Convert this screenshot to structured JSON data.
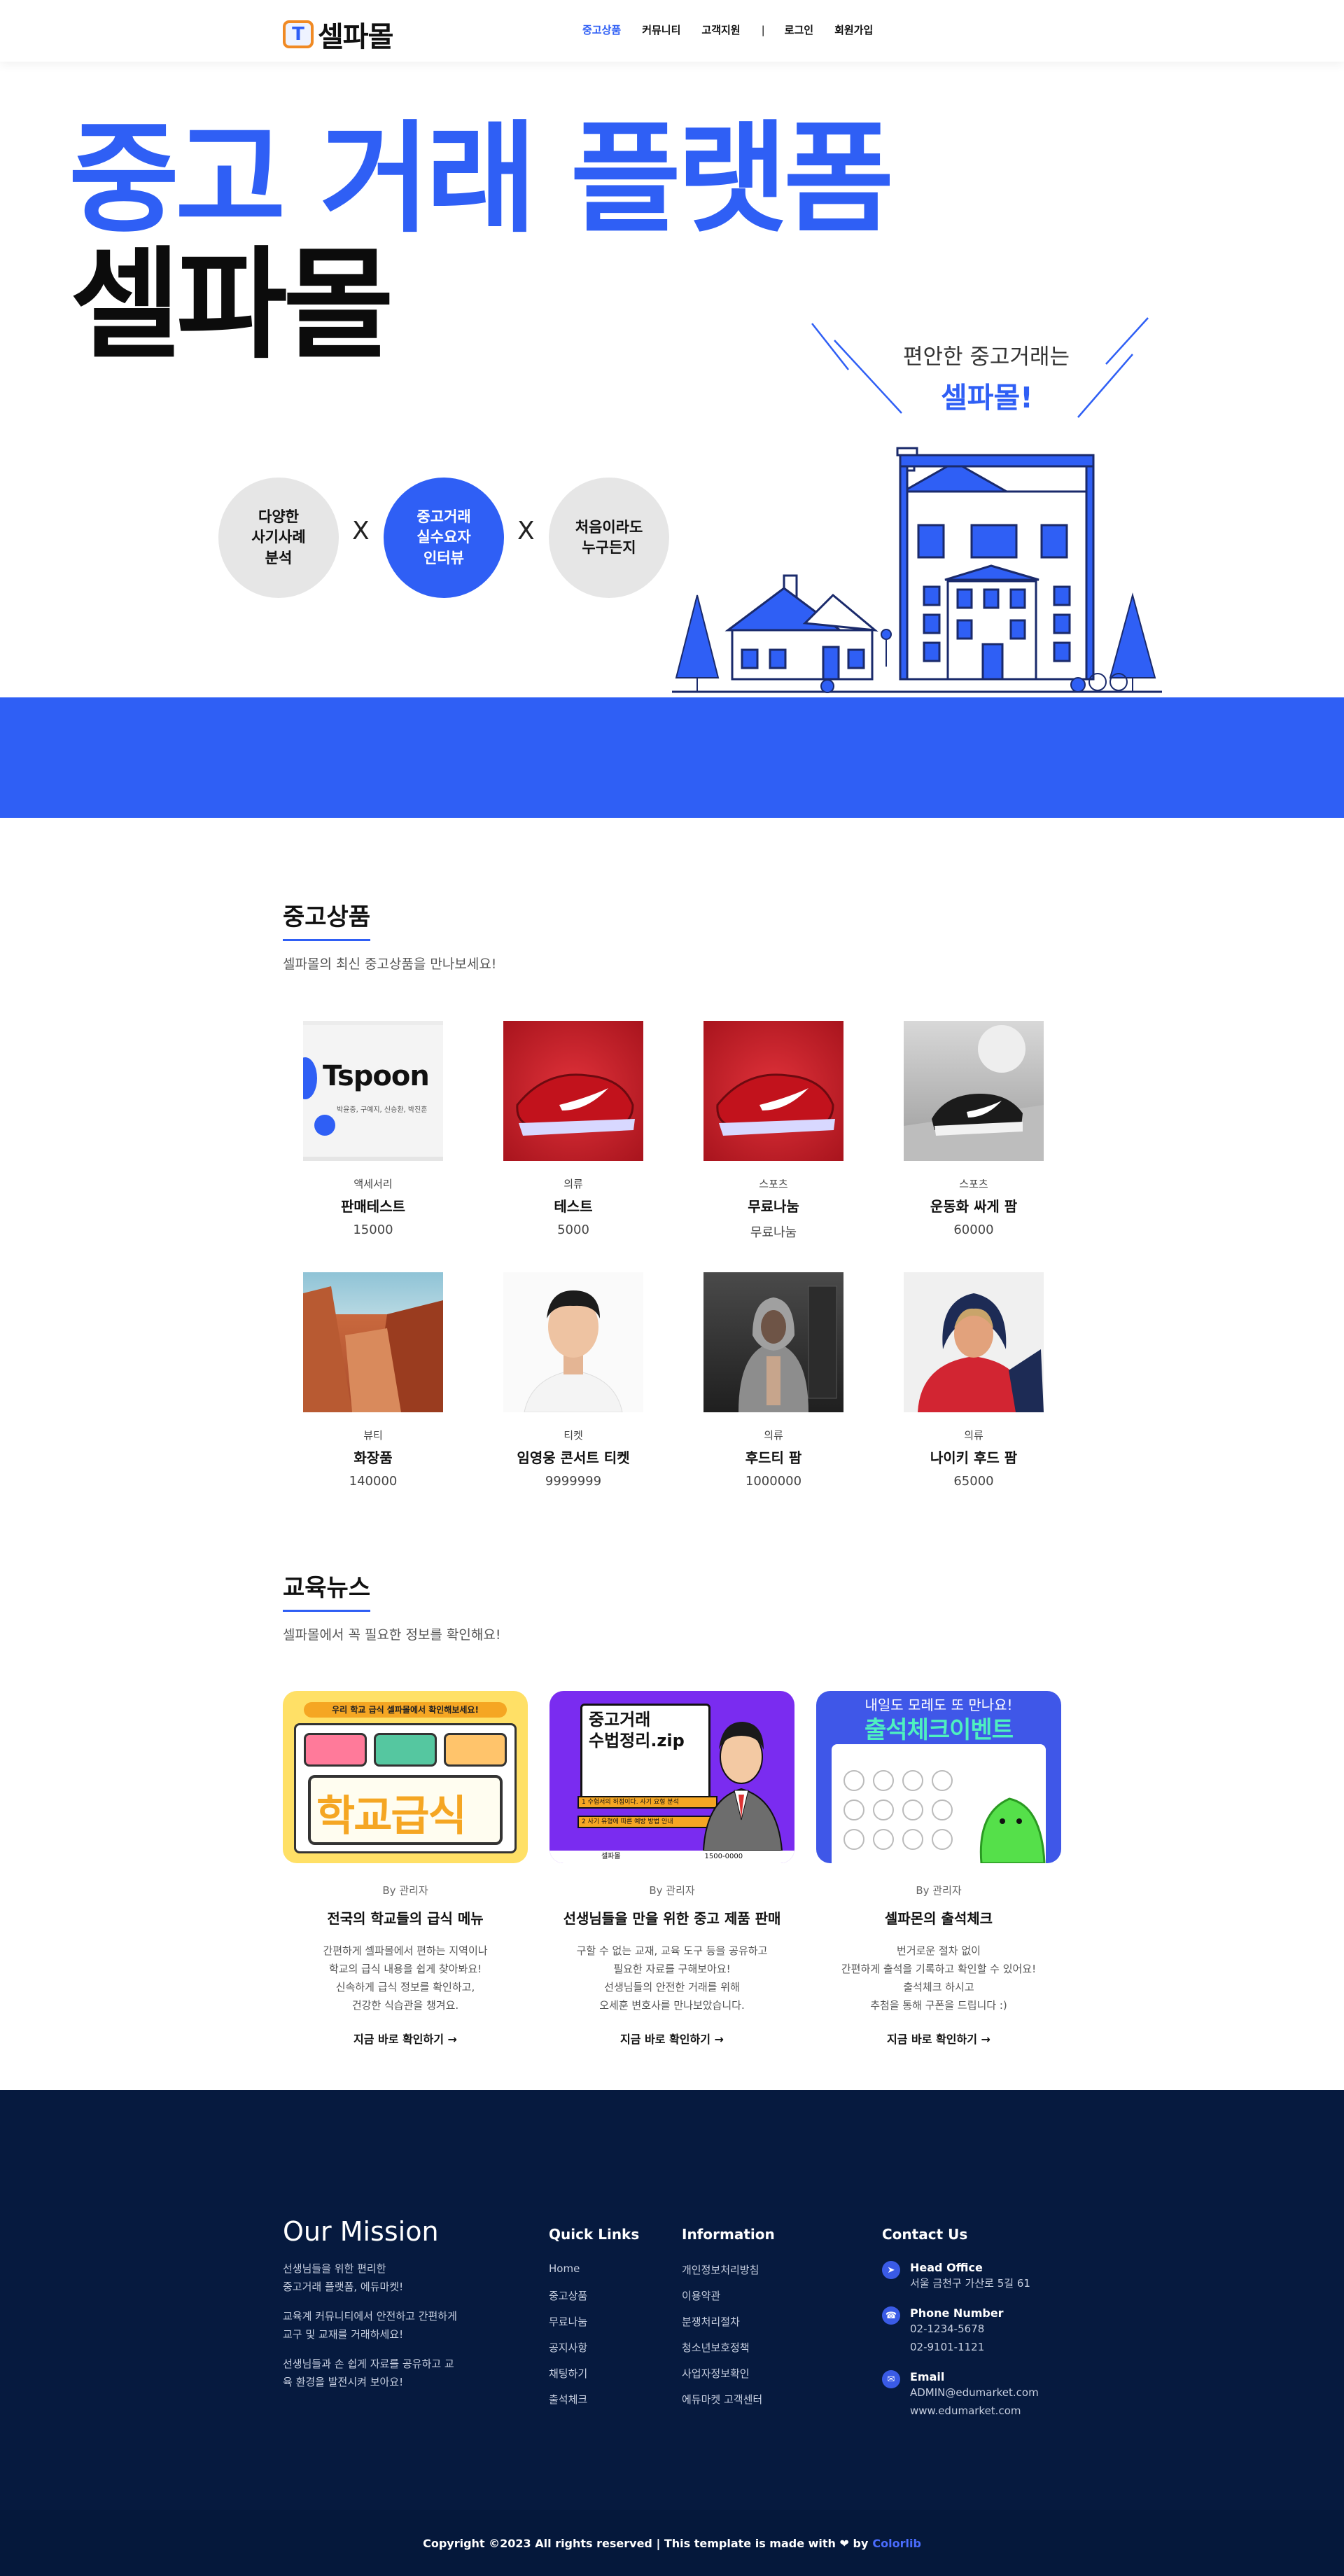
{
  "nav": {
    "logo_text": "셀파몰",
    "items": [
      "중고상품",
      "커뮤니티",
      "고객지원",
      "|",
      "로그인",
      "회원가입"
    ],
    "active": "중고상품"
  },
  "hero": {
    "line1": "중고 거래 플랫폼",
    "line2": "셀파몰",
    "bubbles": [
      "다양한\n사기사례\n분석",
      "중고거래\n실수요자\n인터뷰",
      "처음이라도\n누구든지"
    ],
    "x_mark": "X",
    "town_caption": "편안한 중고거래는",
    "town_brand": "셀파몰!"
  },
  "products": {
    "title": "중고상품",
    "subtitle": "셀파몰의 최신 중고상품을 만나보세요!",
    "items": [
      {
        "category": "액세서리",
        "name": "판매테스트",
        "price": "15000",
        "image": "tspoon-banner"
      },
      {
        "category": "의류",
        "name": "테스트",
        "price": "5000",
        "image": "red-sneaker"
      },
      {
        "category": "스포츠",
        "name": "무료나눔",
        "price": "무료나눔",
        "image": "red-sneaker"
      },
      {
        "category": "스포츠",
        "name": "운동화 싸게 팜",
        "price": "60000",
        "image": "black-sneaker"
      },
      {
        "category": "뷰티",
        "name": "화장품",
        "price": "140000",
        "image": "canyon"
      },
      {
        "category": "티켓",
        "name": "임영웅 콘서트 티켓",
        "price": "9999999",
        "image": "man-portrait"
      },
      {
        "category": "의류",
        "name": "후드티 팜",
        "price": "1000000",
        "image": "hoodie-man"
      },
      {
        "category": "의류",
        "name": "나이키 후드 팜",
        "price": "65000",
        "image": "hoodie-woman"
      }
    ],
    "tspoon_brand": "Tspoon",
    "tspoon_names": "박윤중, 구예지, 신승환, 박진훈"
  },
  "news": {
    "title": "교육뉴스",
    "subtitle": "셀파몰에서 꼭 필요한 정보를 확인해요!",
    "items": [
      {
        "by": "By 관리자",
        "title": "전국의 학교들의 급식 메뉴",
        "desc": [
          "간편하게 셀파몰에서 편하는 지역이나",
          "학교의 급식 내용을 쉽게 찾아봐요!",
          "신속하게 급식 정보를 확인하고,",
          "건강한 식습관을 챙겨요."
        ],
        "link": "지금 바로 확인하기 →",
        "banner_top": "우리 학교 급식 셀파몰에서 확인해보세요!",
        "banner_main": "학교급식"
      },
      {
        "by": "By 관리자",
        "title": "선생님들을 만을 위한 중고 제품 판매",
        "desc": [
          "구할 수 없는 교재, 교육 도구 등을 공유하고",
          "필요한 자료를 구해보아요!",
          "선생님들의 안전한 거래를 위해",
          "오세훈 변호사를 만나보았습니다."
        ],
        "link": "지금 바로 확인하기 →",
        "banner_main": "중고거래\n수법정리.zip",
        "banner_item1": "1 수험서의 허점이다. 사기 요형 분석",
        "banner_item2": "2 사기 유형에 따른 예방 방법 안내",
        "banner_footer_left": "셀파몰",
        "banner_footer_right": "1500-0000"
      },
      {
        "by": "By 관리자",
        "title": "셀파몬의 출석체크",
        "desc": [
          "번거로운 절차 없이",
          "간편하게 출석을 기록하고 확인할 수 있어요!",
          "출석체크 하시고",
          "추첨을 통해 구폰을 드립니다 :)"
        ],
        "link": "지금 바로 확인하기 →",
        "banner_top": "내일도 모레도 또 만나요!",
        "banner_main": "출석체크이벤트"
      }
    ]
  },
  "footer": {
    "mission_title": "Our Mission",
    "mission_paragraphs": [
      [
        "선생님들을 위한 편리한",
        "중고거래 플랫폼, 에듀마켓!"
      ],
      [
        "교육계 커뮤니티에서 안전하고 간편하게",
        "교구 및 교재를 거래하세요!"
      ],
      [
        "선생님들과 손 쉽게 자료를 공유하고 교",
        "육 환경을 발전시켜 보아요!"
      ]
    ],
    "quick_links_title": "Quick Links",
    "quick_links": [
      "Home",
      "중고상품",
      "무료나눔",
      "공지사항",
      "채팅하기",
      "출석체크"
    ],
    "information_title": "Information",
    "information": [
      "개인정보처리방침",
      "이용약관",
      "분쟁처리절차",
      "청소년보호정책",
      "사업자정보확인",
      "에듀마켓 고객센터"
    ],
    "contact_title": "Contact Us",
    "contacts": [
      {
        "icon": "paper-plane-icon",
        "title": "Head Office",
        "values": [
          "서울 금천구 가산로 5길 61"
        ]
      },
      {
        "icon": "phone-icon",
        "title": "Phone Number",
        "values": [
          "02-1234-5678",
          "02-9101-1121"
        ]
      },
      {
        "icon": "mail-icon",
        "title": "Email",
        "values": [
          "ADMIN@edumarket.com",
          "www.edumarket.com"
        ]
      }
    ],
    "copyright": "Copyright ©2023 All rights reserved | This template is made with ❤ by",
    "copyright_brand": "Colorlib"
  },
  "colors": {
    "accent": "#2f5ff5",
    "footer": "#061a3f",
    "logo_border": "#f08a24"
  }
}
